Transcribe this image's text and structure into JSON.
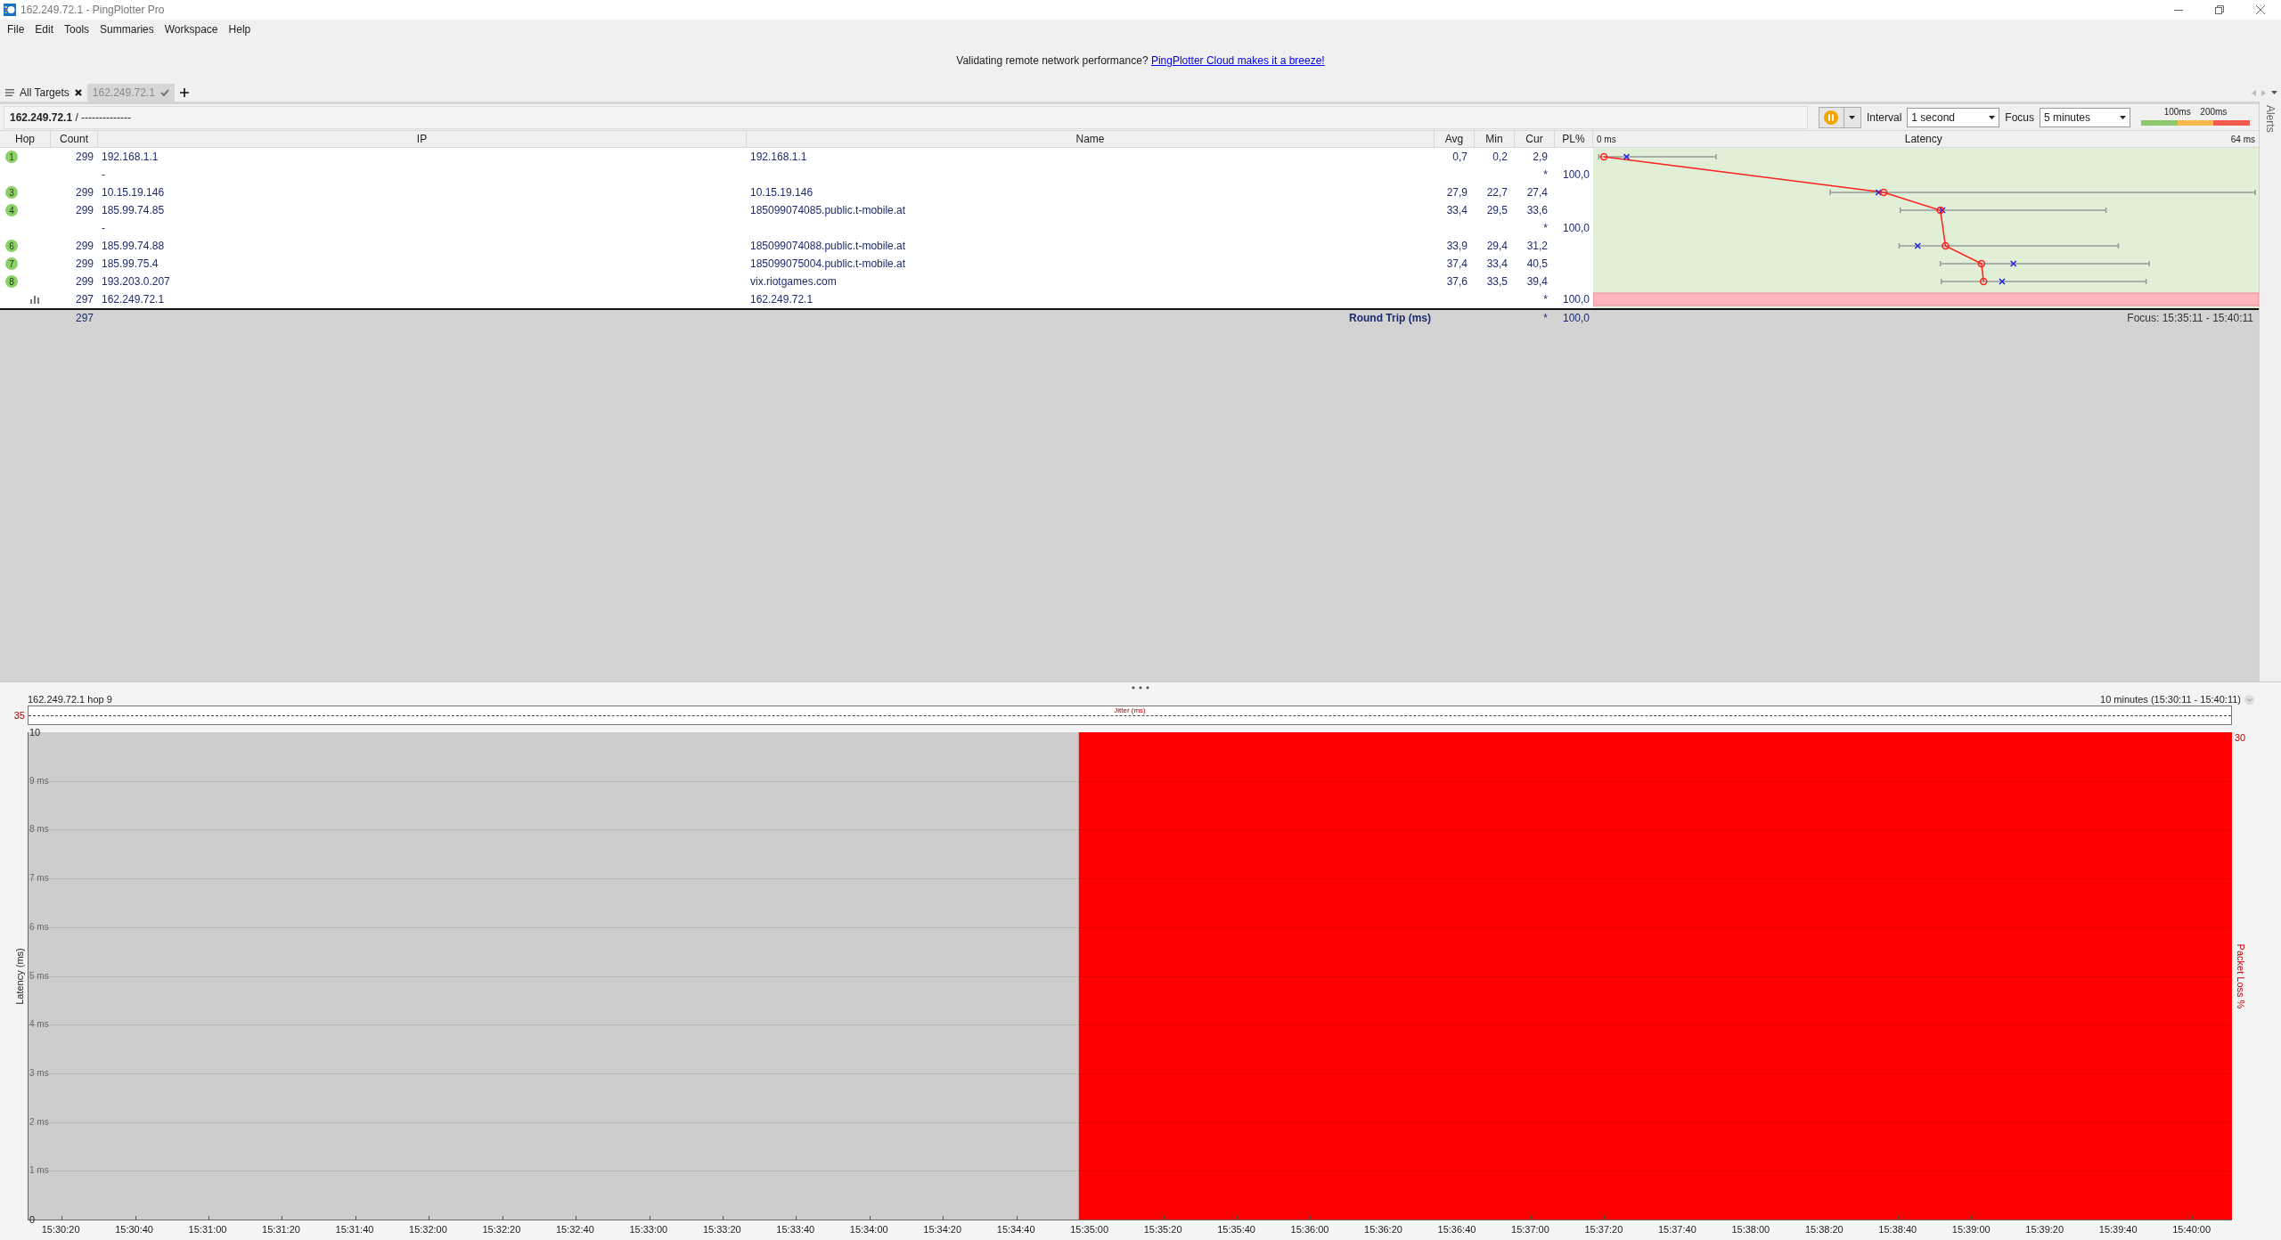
{
  "window": {
    "title": "162.249.72.1 - PingPlotter Pro"
  },
  "menu": [
    "File",
    "Edit",
    "Tools",
    "Summaries",
    "Workspace",
    "Help"
  ],
  "banner": {
    "text": "Validating remote network performance?",
    "link": "PingPlotter Cloud makes it a breeze!"
  },
  "tabs": [
    {
      "label": "All Targets",
      "kind": "all",
      "selected": false
    },
    {
      "label": "162.249.72.1",
      "kind": "target",
      "selected": true
    }
  ],
  "target_bar": {
    "path": "**162.249.72.1** /  --------------",
    "interval_label": "Interval",
    "interval": "1 second",
    "focus_label": "Focus",
    "focus": "5 minutes",
    "legend": {
      "labels": [
        "100ms",
        "200ms"
      ],
      "segments": [
        {
          "color": "#8cc86c"
        },
        {
          "color": "#f8b84a"
        },
        {
          "color": "#ef5a4c"
        }
      ]
    }
  },
  "alerts": {
    "label": "Alerts"
  },
  "table": {
    "columns": [
      "Hop",
      "Count",
      "IP",
      "Name",
      "Avg",
      "Min",
      "Cur",
      "PL%"
    ],
    "rows": [
      {
        "kind": "hop",
        "hop": "1",
        "count": "299",
        "ip": "192.168.1.1",
        "name": "192.168.1.1",
        "avg": "0,7",
        "min": "0,2",
        "cur": "2,9"
      },
      {
        "kind": "no_reply",
        "ip": "-",
        "cur": "*",
        "pl": "100,0"
      },
      {
        "kind": "hop",
        "hop": "3",
        "count": "299",
        "ip": "10.15.19.146",
        "name": "10.15.19.146",
        "avg": "27,9",
        "min": "22,7",
        "cur": "27,4"
      },
      {
        "kind": "hop",
        "hop": "4",
        "count": "299",
        "ip": "185.99.74.85",
        "name": "185099074085.public.t-mobile.at",
        "avg": "33,4",
        "min": "29,5",
        "cur": "33,6"
      },
      {
        "kind": "no_reply",
        "ip": "-",
        "cur": "*",
        "pl": "100,0"
      },
      {
        "kind": "hop",
        "hop": "6",
        "count": "299",
        "ip": "185.99.74.88",
        "name": "185099074088.public.t-mobile.at",
        "avg": "33,9",
        "min": "29,4",
        "cur": "31,2"
      },
      {
        "kind": "hop",
        "hop": "7",
        "count": "299",
        "ip": "185.99.75.4",
        "name": "185099075004.public.t-mobile.at",
        "avg": "37,4",
        "min": "33,4",
        "cur": "40,5"
      },
      {
        "kind": "hop",
        "hop": "8",
        "count": "299",
        "ip": "193.203.0.207",
        "name": "vix.riotgames.com",
        "avg": "37,6",
        "min": "33,5",
        "cur": "39,4"
      },
      {
        "kind": "target",
        "count": "297",
        "ip": "162.249.72.1",
        "name": "162.249.72.1",
        "cur": "*",
        "pl": "100,0"
      }
    ],
    "round_trip": {
      "count": "297",
      "label": "Round Trip (ms)",
      "cur": "*",
      "pl": "100,0",
      "focus": "Focus: 15:35:11 - 15:40:11"
    },
    "graph_header": {
      "min_label": "0 ms",
      "title": "Latency",
      "max_label": "64 ms"
    }
  },
  "history": {
    "title": "162.249.72.1 hop 9",
    "range": "10 minutes (15:30:11 - 15:40:11)",
    "jitter": {
      "label": "Jitter (ms)",
      "max_label": "35"
    },
    "loss_max_label": "30",
    "chart_data": {
      "type": "area",
      "ylabel": "Latency (ms)",
      "xlim": [
        55811,
        56411
      ],
      "ylim": [
        0,
        10
      ],
      "yticks": [
        {
          "value": 0,
          "label": "0"
        },
        {
          "value": 1,
          "label": "1 ms"
        },
        {
          "value": 2,
          "label": "2 ms"
        },
        {
          "value": 3,
          "label": "3 ms"
        },
        {
          "value": 4,
          "label": "4 ms"
        },
        {
          "value": 5,
          "label": "5 ms"
        },
        {
          "value": 6,
          "label": "6 ms"
        },
        {
          "value": 7,
          "label": "7 ms"
        },
        {
          "value": 8,
          "label": "8 ms"
        },
        {
          "value": 9,
          "label": "9 ms"
        },
        {
          "value": 10,
          "label": "10"
        }
      ],
      "xticks": [
        {
          "value": 55820,
          "label": "15:30:20"
        },
        {
          "value": 55840,
          "label": "15:30:40"
        },
        {
          "value": 55860,
          "label": "15:31:00"
        },
        {
          "value": 55880,
          "label": "15:31:20"
        },
        {
          "value": 55900,
          "label": "15:31:40"
        },
        {
          "value": 55920,
          "label": "15:32:00"
        },
        {
          "value": 55940,
          "label": "15:32:20"
        },
        {
          "value": 55960,
          "label": "15:32:40"
        },
        {
          "value": 55980,
          "label": "15:33:00"
        },
        {
          "value": 56000,
          "label": "15:33:20"
        },
        {
          "value": 56020,
          "label": "15:33:40"
        },
        {
          "value": 56040,
          "label": "15:34:00"
        },
        {
          "value": 56060,
          "label": "15:34:20"
        },
        {
          "value": 56080,
          "label": "15:34:40"
        },
        {
          "value": 56100,
          "label": "15:35:00"
        },
        {
          "value": 56120,
          "label": "15:35:20"
        },
        {
          "value": 56140,
          "label": "15:35:40"
        },
        {
          "value": 56160,
          "label": "15:36:00"
        },
        {
          "value": 56180,
          "label": "15:36:20"
        },
        {
          "value": 56200,
          "label": "15:36:40"
        },
        {
          "value": 56220,
          "label": "15:37:00"
        },
        {
          "value": 56240,
          "label": "15:37:20"
        },
        {
          "value": 56260,
          "label": "15:37:40"
        },
        {
          "value": 56280,
          "label": "15:38:00"
        },
        {
          "value": 56300,
          "label": "15:38:20"
        },
        {
          "value": 56320,
          "label": "15:38:40"
        },
        {
          "value": 56340,
          "label": "15:39:00"
        },
        {
          "value": 56360,
          "label": "15:39:20"
        },
        {
          "value": 56380,
          "label": "15:39:40"
        },
        {
          "value": 56400,
          "label": "15:40:00"
        }
      ],
      "x": [
        55811,
        56097,
        56097,
        56411
      ],
      "series": [
        {
          "name": "Packet Loss %",
          "color": "#ff0000",
          "values": [
            0,
            0,
            10,
            10
          ]
        }
      ]
    }
  }
}
